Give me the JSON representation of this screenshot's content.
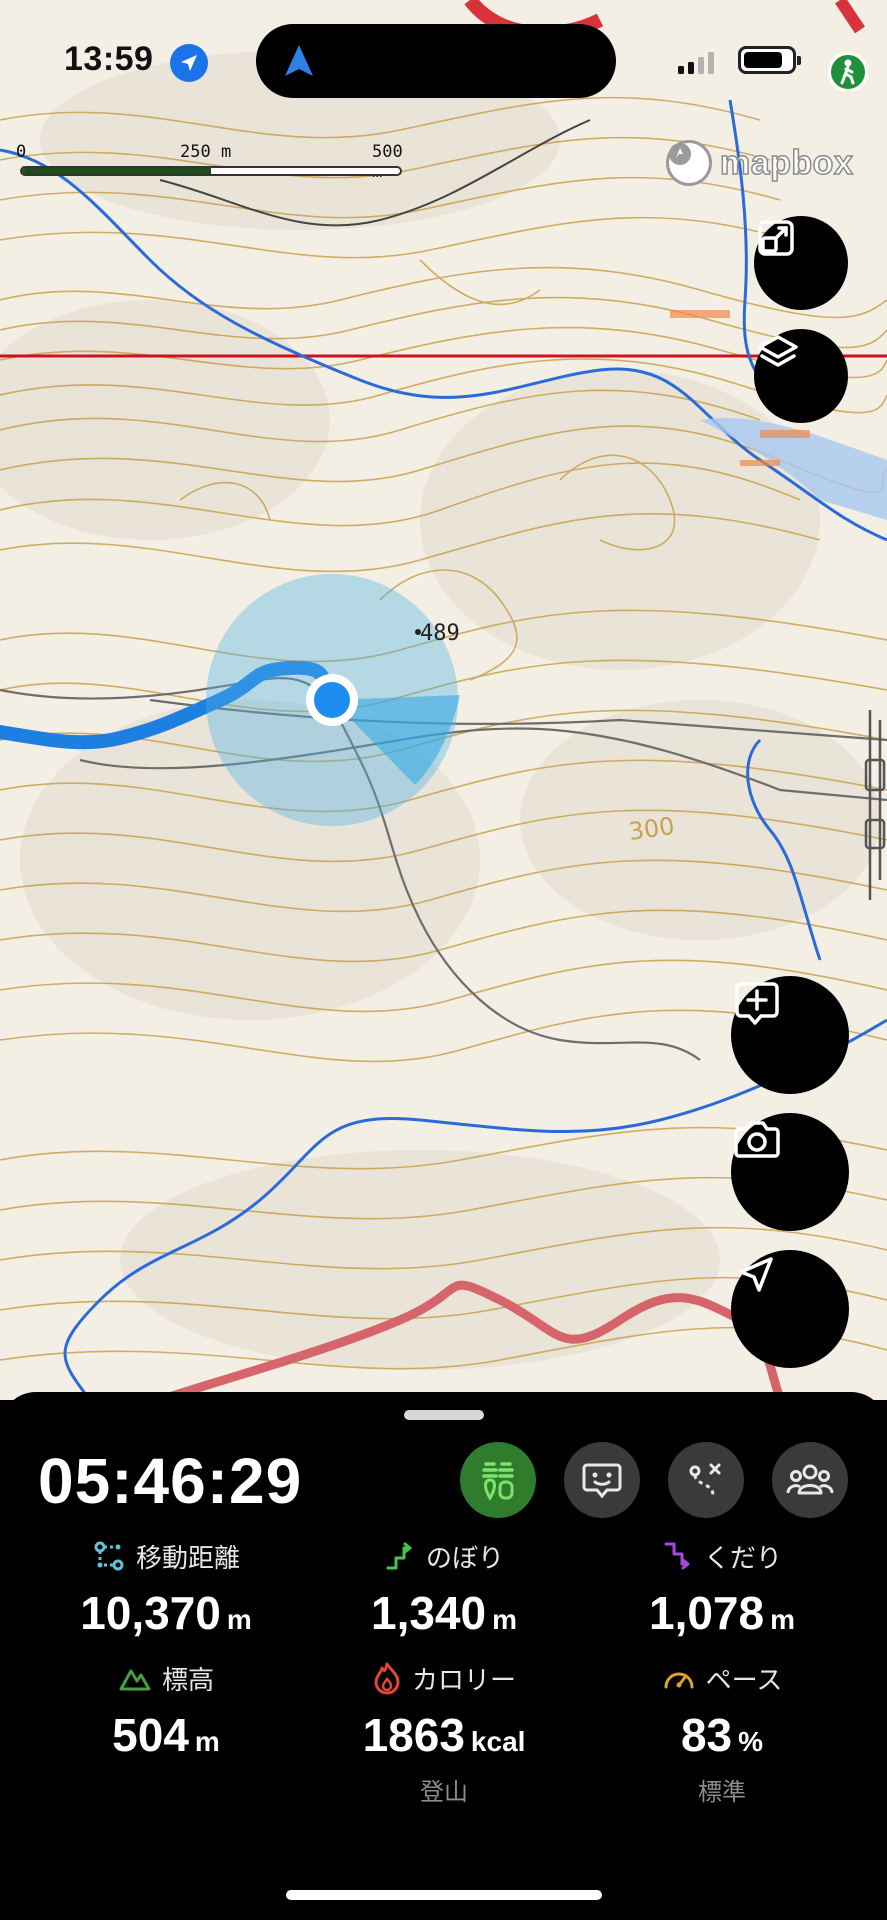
{
  "status_bar": {
    "time": "13:59",
    "battery_level": 0.85,
    "icons": [
      "location-arrow-icon",
      "navigation-icon",
      "signal-icon",
      "battery-icon",
      "hiker-icon"
    ]
  },
  "map": {
    "scale_labels": [
      "0",
      "250 m",
      "500 m"
    ],
    "scale_progress": 0.5,
    "attribution": "mapbox",
    "elevation_labels": [
      "489",
      "300"
    ],
    "controls": [
      {
        "name": "expand-button",
        "icon": "expand-icon"
      },
      {
        "name": "layers-button",
        "icon": "layers-icon"
      },
      {
        "name": "add-memo-button",
        "icon": "add-note-icon"
      },
      {
        "name": "camera-button",
        "icon": "camera-icon"
      },
      {
        "name": "locate-button",
        "icon": "location-arrow-icon"
      }
    ]
  },
  "panel": {
    "elapsed": "05:46:29",
    "modes": [
      {
        "name": "mode-hiking",
        "icon": "hiking-icon",
        "active": true
      },
      {
        "name": "mode-face",
        "icon": "face-icon",
        "active": false
      },
      {
        "name": "mode-route",
        "icon": "route-icon",
        "active": false
      },
      {
        "name": "mode-group",
        "icon": "group-icon",
        "active": false
      }
    ],
    "stats": {
      "distance": {
        "label": "移動距離",
        "value": "10,370",
        "unit": "m",
        "color": "#5ec3d6"
      },
      "ascent": {
        "label": "のぼり",
        "value": "1,340",
        "unit": "m",
        "color": "#46c74a"
      },
      "descent": {
        "label": "くだり",
        "value": "1,078",
        "unit": "m",
        "color": "#a24bdb"
      },
      "elevation": {
        "label": "標高",
        "value": "504",
        "unit": "m",
        "color": "#46a046"
      },
      "calories": {
        "label": "カロリー",
        "value": "1863",
        "unit": "kcal",
        "sub": "登山",
        "color": "#e2453a"
      },
      "pace": {
        "label": "ペース",
        "value": "83",
        "unit": "%",
        "sub": "標準",
        "color": "#e0a128"
      }
    }
  }
}
